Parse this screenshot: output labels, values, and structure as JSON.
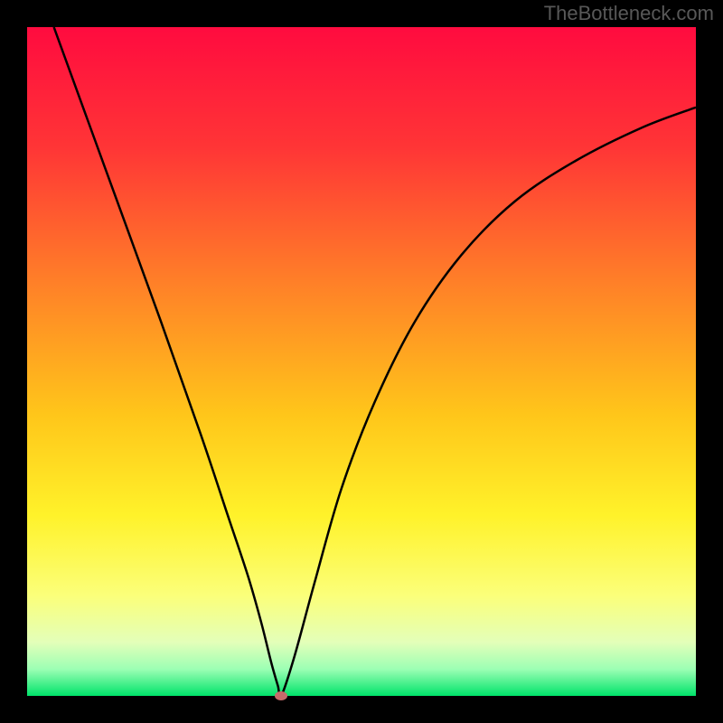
{
  "watermark": "TheBottleneck.com",
  "chart_data": {
    "type": "line",
    "title": "",
    "xlabel": "",
    "ylabel": "",
    "xlim": [
      0,
      100
    ],
    "ylim": [
      0,
      100
    ],
    "series": [
      {
        "name": "bottleneck-curve",
        "x": [
          4,
          12,
          20,
          26,
          30,
          33,
          35,
          36.5,
          37.5,
          38,
          40,
          43,
          47,
          52,
          58,
          65,
          73,
          82,
          92,
          100
        ],
        "values": [
          100,
          78,
          56,
          39,
          27,
          18,
          11,
          5,
          1.5,
          0,
          6,
          17,
          31,
          44,
          56,
          66,
          74,
          80,
          85,
          88
        ]
      }
    ],
    "minimum_marker": {
      "x": 38,
      "y": 0
    },
    "background_gradient": {
      "stops": [
        {
          "pos": 0.0,
          "color": "#ff0b3f"
        },
        {
          "pos": 0.18,
          "color": "#ff3536"
        },
        {
          "pos": 0.38,
          "color": "#ff7f28"
        },
        {
          "pos": 0.58,
          "color": "#ffc61a"
        },
        {
          "pos": 0.73,
          "color": "#fff22a"
        },
        {
          "pos": 0.85,
          "color": "#fbff7a"
        },
        {
          "pos": 0.92,
          "color": "#e3ffb9"
        },
        {
          "pos": 0.96,
          "color": "#9cffb4"
        },
        {
          "pos": 1.0,
          "color": "#00e36a"
        }
      ]
    }
  }
}
